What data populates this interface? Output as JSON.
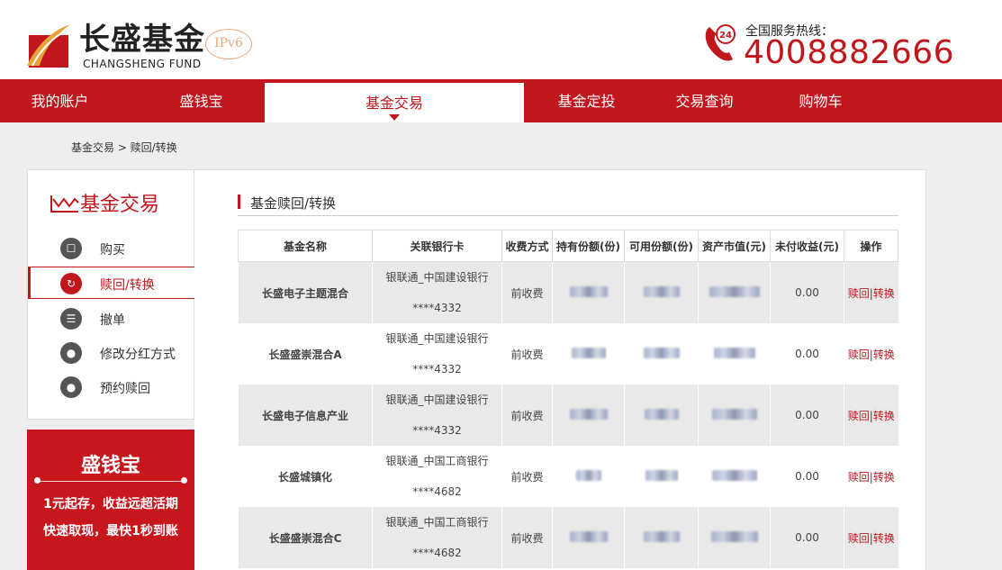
{
  "header": {
    "logo_cn": "长盛基金",
    "logo_en": "CHANGSHENG FUND",
    "ipv6_badge": "IPv6",
    "hotline_label": "全国服务热线：",
    "hotline_number": "4008882666",
    "hotline_icon_text": "24"
  },
  "nav": {
    "items": [
      {
        "label": "我的账户"
      },
      {
        "label": "盛钱宝"
      },
      {
        "label": "基金交易"
      },
      {
        "label": "基金定投"
      },
      {
        "label": "交易查询"
      },
      {
        "label": "购物车"
      }
    ],
    "active": "基金交易"
  },
  "breadcrumb": "基金交易 > 赎回/转换",
  "sidebar": {
    "title": "基金交易",
    "items": [
      {
        "label": "购买",
        "icon": "basket-icon"
      },
      {
        "label": "赎回/转换",
        "icon": "refresh-icon"
      },
      {
        "label": "撤单",
        "icon": "document-icon"
      },
      {
        "label": "修改分红方式",
        "icon": "coins-icon"
      },
      {
        "label": "预约赎回",
        "icon": "coins-icon"
      }
    ],
    "active": "赎回/转换"
  },
  "promo": {
    "title": "盛钱宝",
    "line1": "1元起存，收益远超活期",
    "line2": "快速取现，最快1秒到账"
  },
  "main": {
    "section_title": "基金赎回/转换",
    "columns": [
      "基金名称",
      "关联银行卡",
      "收费方式",
      "持有份额(份)",
      "可用份额(份)",
      "资产市值(元)",
      "未付收益(元)",
      "操作"
    ],
    "rows": [
      {
        "name": "长盛电子主题混合",
        "bank": "银联通_中国建设银行",
        "card": "****4332",
        "fee": "前收费",
        "unpaid": "0.00",
        "redeem": "赎回",
        "sep": "|",
        "convert": "转换"
      },
      {
        "name": "长盛盛崇混合A",
        "bank": "银联通_中国建设银行",
        "card": "****4332",
        "fee": "前收费",
        "unpaid": "0.00",
        "redeem": "赎回",
        "sep": "|",
        "convert": "转换"
      },
      {
        "name": "长盛电子信息产业",
        "bank": "银联通_中国建设银行",
        "card": "****4332",
        "fee": "前收费",
        "unpaid": "0.00",
        "redeem": "赎回",
        "sep": "|",
        "convert": "转换"
      },
      {
        "name": "长盛城镇化",
        "bank": "银联通_中国工商银行",
        "card": "****4682",
        "fee": "前收费",
        "unpaid": "0.00",
        "redeem": "赎回",
        "sep": "|",
        "convert": "转换"
      },
      {
        "name": "长盛盛崇混合C",
        "bank": "银联通_中国工商银行",
        "card": "****4682",
        "fee": "前收费",
        "unpaid": "0.00",
        "redeem": "赎回",
        "sep": "|",
        "convert": "转换"
      }
    ]
  },
  "colors": {
    "brand_red": "#c0161c",
    "fund_name": "#a8101a"
  }
}
